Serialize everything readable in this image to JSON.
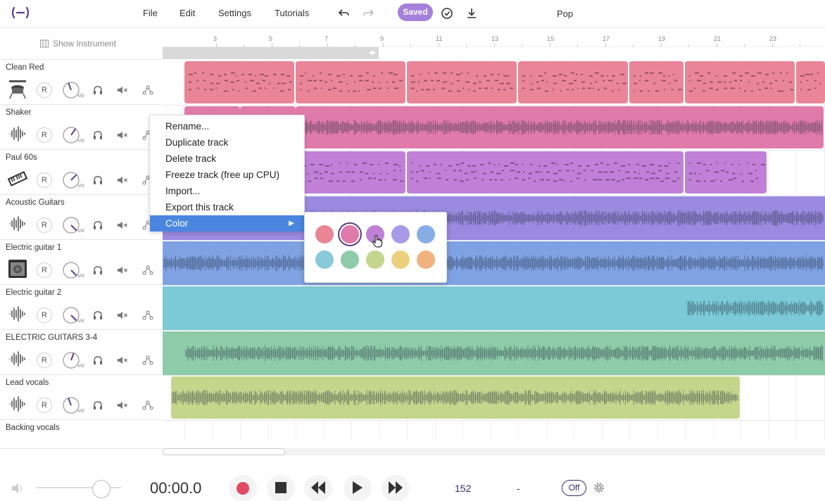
{
  "menu": {
    "file": "File",
    "edit": "Edit",
    "settings": "Settings",
    "tutorials": "Tutorials",
    "saved": "Saved",
    "project_name": "Pop"
  },
  "left_panel": {
    "show_instrument": "Show Instrument"
  },
  "ruler": {
    "labels": [
      "3",
      "5",
      "7",
      "9",
      "11",
      "13",
      "15",
      "17",
      "19",
      "21",
      "23"
    ]
  },
  "tracks": [
    {
      "name": "Clean Red",
      "icon": "drum-kit-icon",
      "color": "#ea8597"
    },
    {
      "name": "Shaker",
      "icon": "waveform-icon",
      "color": "#e07aab"
    },
    {
      "name": "Paul 60s",
      "icon": "keyboard-icon",
      "color": "#c080d8"
    },
    {
      "name": "Acoustic Guitars",
      "icon": "waveform-icon",
      "color": "#9a8ae0"
    },
    {
      "name": "Electric guitar 1",
      "icon": "amp-icon",
      "color": "#7ea2e2"
    },
    {
      "name": "Electric guitar 2",
      "icon": "waveform-icon",
      "color": "#7ccad8"
    },
    {
      "name": "ELECTRIC GUITARS 3-4",
      "icon": "waveform-icon",
      "color": "#8dcba9"
    },
    {
      "name": "Lead vocals",
      "icon": "waveform-icon",
      "color": "#c4d68c"
    },
    {
      "name": "Backing vocals",
      "icon": "waveform-icon",
      "color": "#e6d688"
    }
  ],
  "track_controls": {
    "record": "R",
    "vol": "Vol"
  },
  "context_menu": {
    "items": [
      "Rename...",
      "Duplicate track",
      "Delete track",
      "Freeze track (free up CPU)",
      "Import...",
      "Export this track",
      "Color"
    ],
    "active": "Color"
  },
  "color_palette": {
    "swatches": [
      "#ea8597",
      "#e07aab",
      "#c080d8",
      "#a99ae8",
      "#87aee4",
      "#88cad8",
      "#8dcba9",
      "#c4d68c",
      "#ebd17e",
      "#f0b27e"
    ],
    "selected": "#e07aab"
  },
  "transport": {
    "time": "00:00.0",
    "bpm": "152",
    "key": "-",
    "metronome": "Off"
  }
}
